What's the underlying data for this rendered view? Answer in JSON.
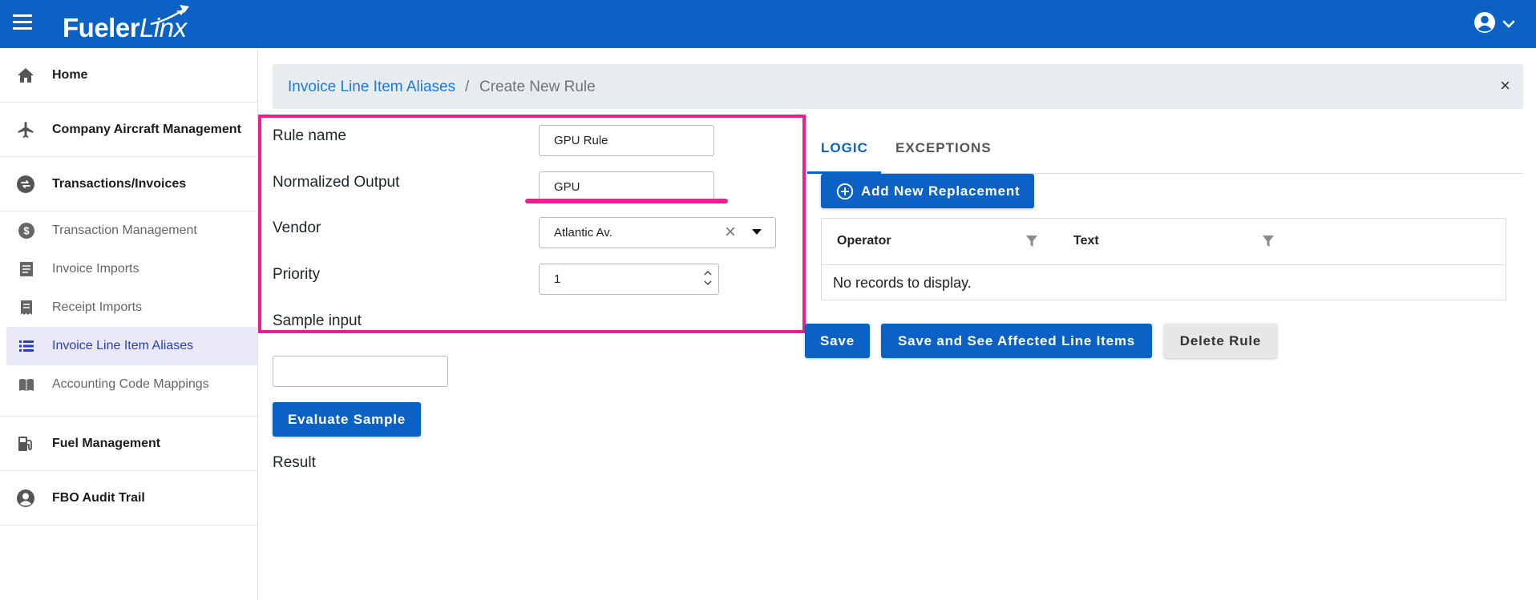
{
  "app": {
    "logo_main": "Fueler",
    "logo_italic": "Linx",
    "brand_color": "#0b62c4",
    "highlight_color": "#ec1f8e"
  },
  "header": {
    "menu_icon": "hamburger-icon",
    "user_icon": "user-circle-icon"
  },
  "sidebar": {
    "items": [
      {
        "label": "Home",
        "icon": "home-icon"
      },
      {
        "label": "Company Aircraft Management",
        "icon": "airplane-icon"
      },
      {
        "label": "Transactions/Invoices",
        "icon": "exchange-icon"
      },
      {
        "label": "Fuel Management",
        "icon": "fuel-pump-icon"
      },
      {
        "label": "FBO Audit Trail",
        "icon": "user-circle-icon"
      }
    ],
    "sub_items": [
      {
        "label": "Transaction Management",
        "icon": "dollar-circle-icon"
      },
      {
        "label": "Invoice Imports",
        "icon": "document-icon"
      },
      {
        "label": "Receipt Imports",
        "icon": "receipt-icon"
      },
      {
        "label": "Invoice Line Item Aliases",
        "icon": "list-icon",
        "active": true
      },
      {
        "label": "Accounting Code Mappings",
        "icon": "book-icon"
      }
    ]
  },
  "breadcrumb": {
    "parent": "Invoice Line Item Aliases",
    "separator": "/",
    "current": "Create New Rule",
    "close": "×"
  },
  "form": {
    "rule_name_label": "Rule name",
    "rule_name_value": "GPU Rule",
    "normalized_output_label": "Normalized Output",
    "normalized_output_value": "GPU",
    "vendor_label": "Vendor",
    "vendor_value": "Atlantic Av.",
    "priority_label": "Priority",
    "priority_value": "1",
    "sample_input_label": "Sample input",
    "sample_input_value": "",
    "evaluate_button": "Evaluate Sample",
    "result_label": "Result"
  },
  "tabs": [
    {
      "label": "LOGIC",
      "active": true
    },
    {
      "label": "EXCEPTIONS",
      "active": false
    }
  ],
  "logic": {
    "add_button": "Add New Replacement",
    "columns": [
      "Operator",
      "Text"
    ],
    "empty_text": "No records to display."
  },
  "actions": {
    "save": "Save",
    "save_and_see": "Save and See Affected Line Items",
    "delete": "Delete Rule"
  }
}
